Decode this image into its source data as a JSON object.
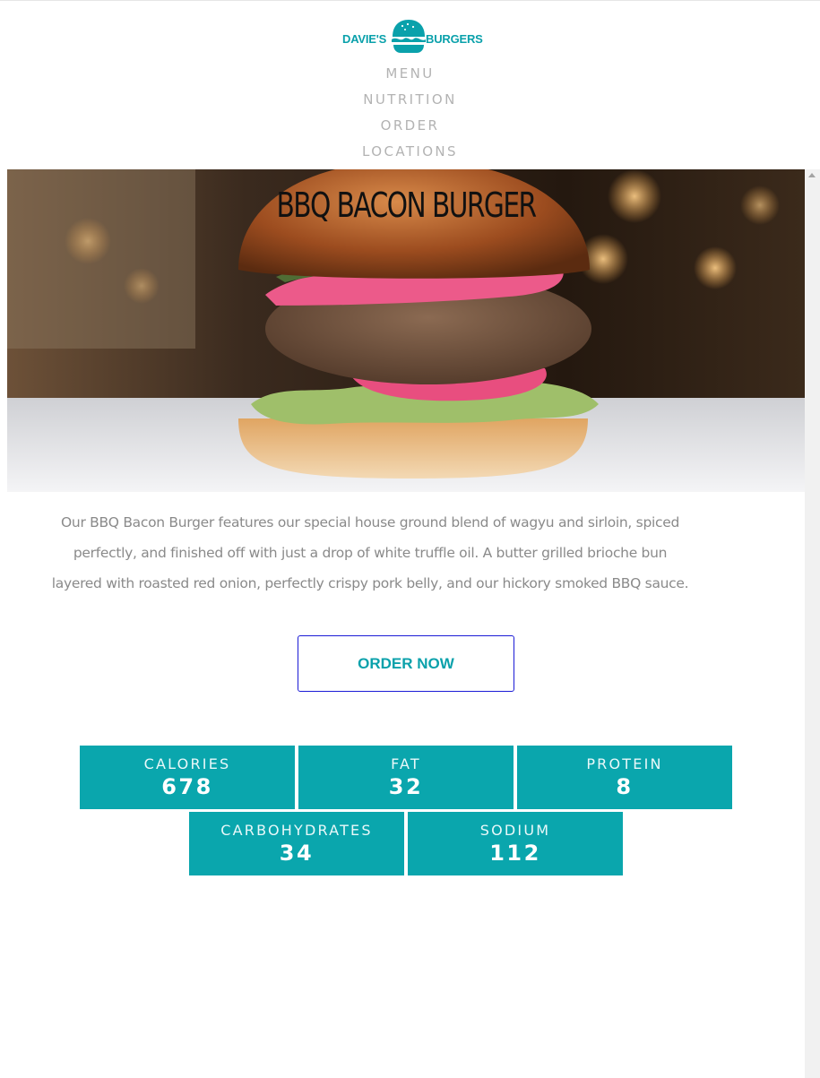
{
  "brand": {
    "name_left": "DAVIE'S",
    "name_right": "BURGERS",
    "color": "#0aa1ab",
    "icon": "burger-logo-icon"
  },
  "nav": {
    "items": [
      {
        "label": "MENU"
      },
      {
        "label": "NUTRITION"
      },
      {
        "label": "ORDER"
      },
      {
        "label": "LOCATIONS"
      }
    ]
  },
  "hero": {
    "title": "BBQ BACON BURGER",
    "image": "burger-photo"
  },
  "description": {
    "lines": [
      "Our BBQ Bacon Burger features our special house ground blend of wagyu and sirloin, spiced",
      "perfectly, and finished off with just a drop of white truffle oil. A butter grilled brioche bun",
      "layered with roasted red onion, perfectly crispy pork belly, and our hickory smoked BBQ sauce."
    ]
  },
  "order_button": {
    "label": "ORDER NOW",
    "border_color": "#1b1bd6"
  },
  "nutrition": {
    "tile_color": "#0aa6ad",
    "items": [
      {
        "label": "CALORIES",
        "value": "678"
      },
      {
        "label": "FAT",
        "value": "32"
      },
      {
        "label": "PROTEIN",
        "value": "8"
      },
      {
        "label": "CARBOHYDRATES",
        "value": "34"
      },
      {
        "label": "SODIUM",
        "value": "112"
      }
    ]
  }
}
